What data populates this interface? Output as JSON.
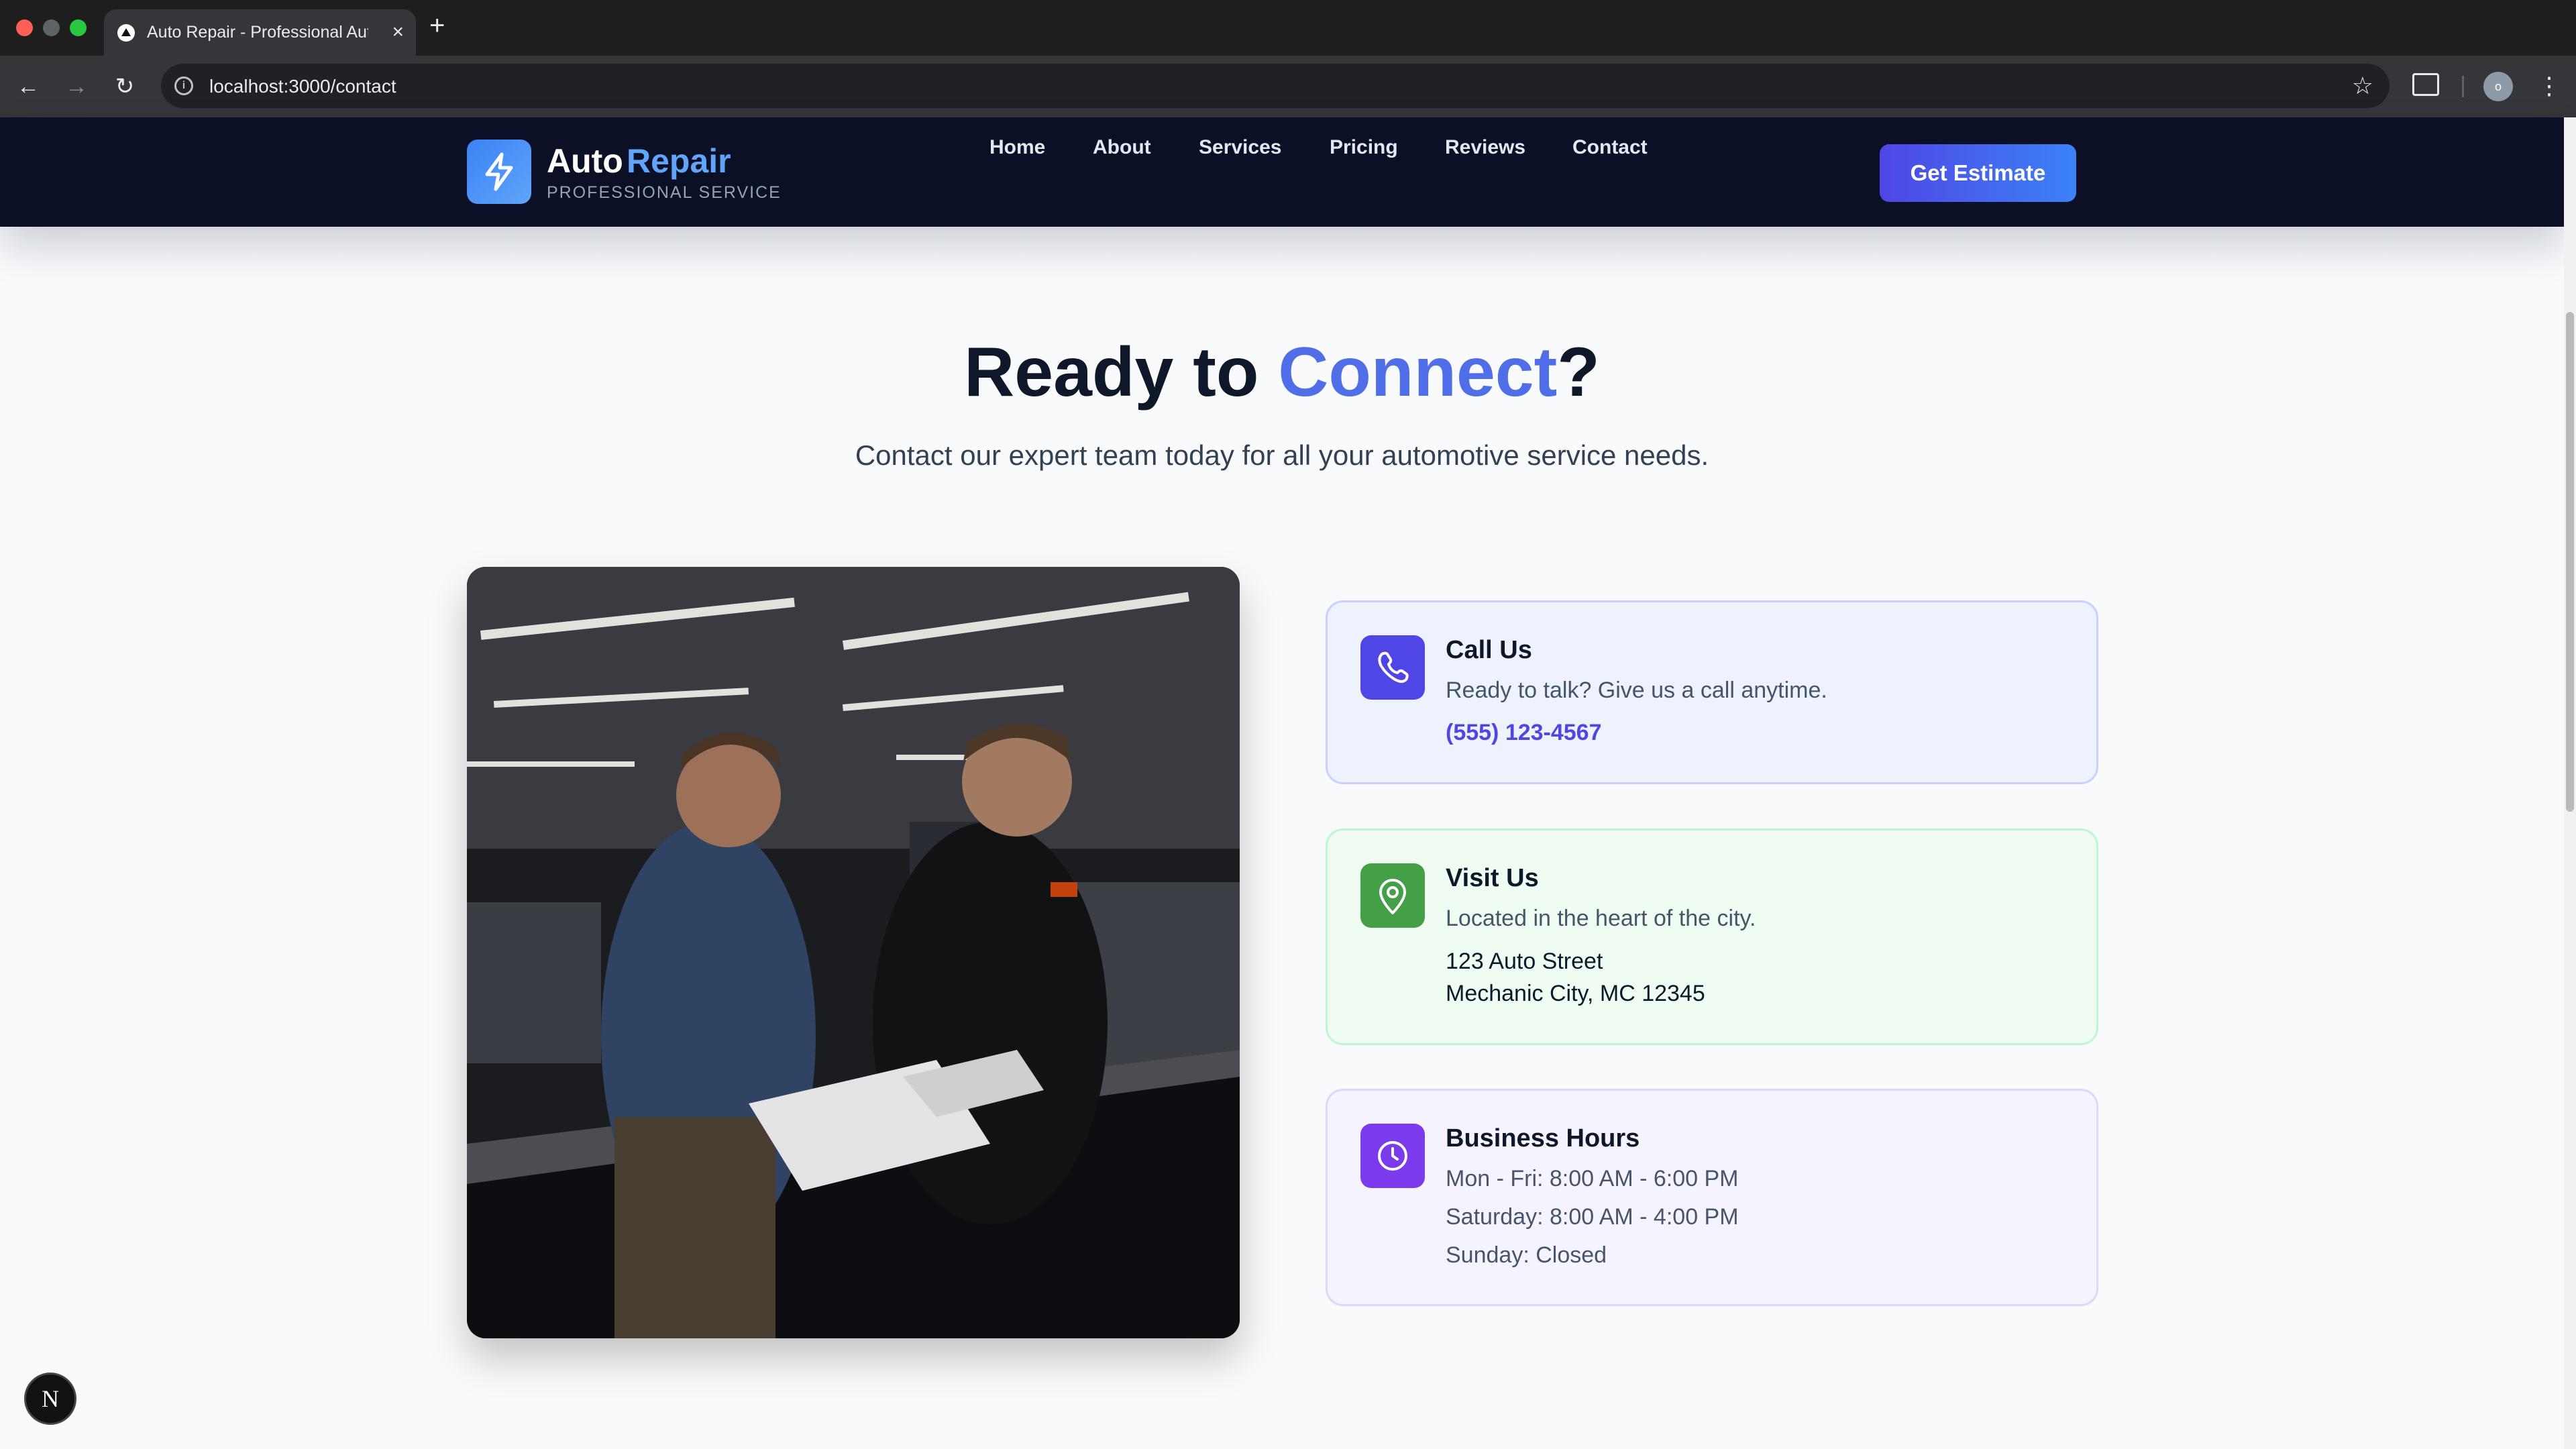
{
  "browser": {
    "tab_title": "Auto Repair - Professional Auto Service",
    "url": "localhost:3000/contact",
    "profile_initial": "o",
    "traffic_light_colors": [
      "#ff5f57",
      "#5f6368",
      "#28c840"
    ]
  },
  "header": {
    "brand_primary": "Auto",
    "brand_accent": "Repair",
    "tagline": "PROFESSIONAL SERVICE",
    "nav": [
      "Home",
      "About",
      "Services",
      "Pricing",
      "Reviews",
      "Contact"
    ],
    "cta_label": "Get Estimate"
  },
  "hero": {
    "heading_start": "Ready to ",
    "heading_accent": "Connect",
    "heading_end": "?",
    "subheading": "Contact our expert team today for all your automotive service needs."
  },
  "cards": {
    "call": {
      "title": "Call Us",
      "description": "Ready to talk? Give us a call anytime.",
      "phone": "(555) 123-4567",
      "icon": "phone-icon",
      "color": "#4f46e5"
    },
    "visit": {
      "title": "Visit Us",
      "description": "Located in the heart of the city.",
      "address_line1": "123 Auto Street",
      "address_line2": "Mechanic City, MC 12345",
      "icon": "map-pin-icon",
      "color": "#16a34a"
    },
    "hours": {
      "title": "Business Hours",
      "weekday": "Mon - Fri: 8:00 AM - 6:00 PM",
      "saturday": "Saturday: 8:00 AM - 4:00 PM",
      "sunday": "Sunday: Closed",
      "icon": "clock-icon",
      "color": "#7c3aed"
    }
  },
  "devtools_badge": "N"
}
